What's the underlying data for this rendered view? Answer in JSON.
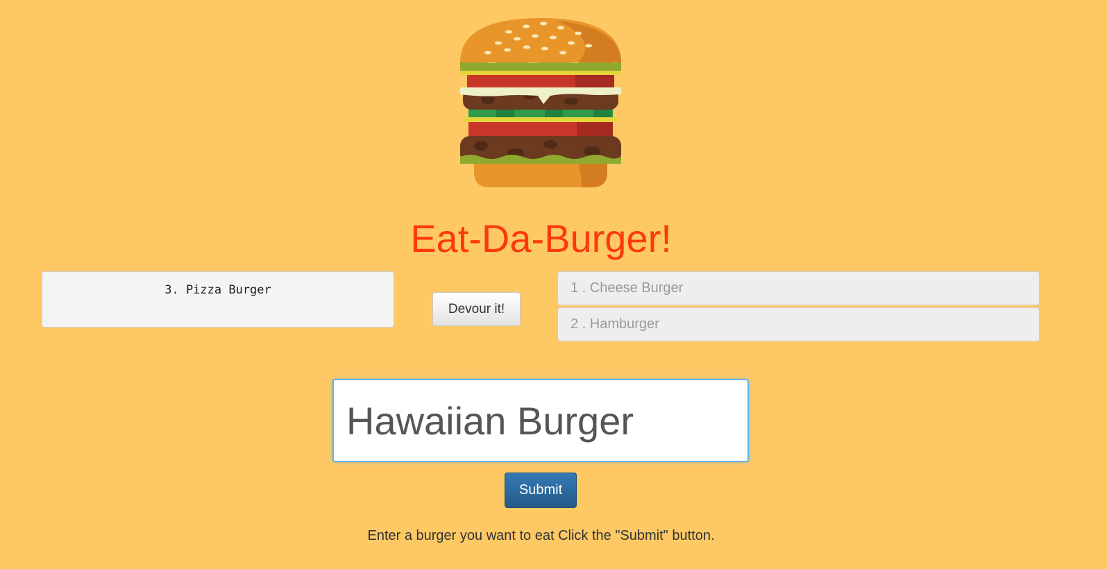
{
  "header": {
    "title": "Eat-Da-Burger!"
  },
  "pending": {
    "items": [
      {
        "number": "3",
        "name": "Pizza Burger",
        "display": "3. Pizza Burger"
      }
    ],
    "devour_label": "Devour it!"
  },
  "devoured": {
    "items": [
      {
        "display": "1 . Cheese Burger"
      },
      {
        "display": "2 . Hamburger"
      }
    ]
  },
  "form": {
    "input_value": "Hawaiian Burger",
    "submit_label": "Submit",
    "instructions": "Enter a burger you want to eat Click the \"Submit\" button."
  },
  "colors": {
    "background": "#fec965",
    "title": "#fc3a08",
    "submit_button": "#286090",
    "input_focus_border": "#66afe9"
  },
  "icons": {
    "logo": "burger-logo-icon"
  }
}
